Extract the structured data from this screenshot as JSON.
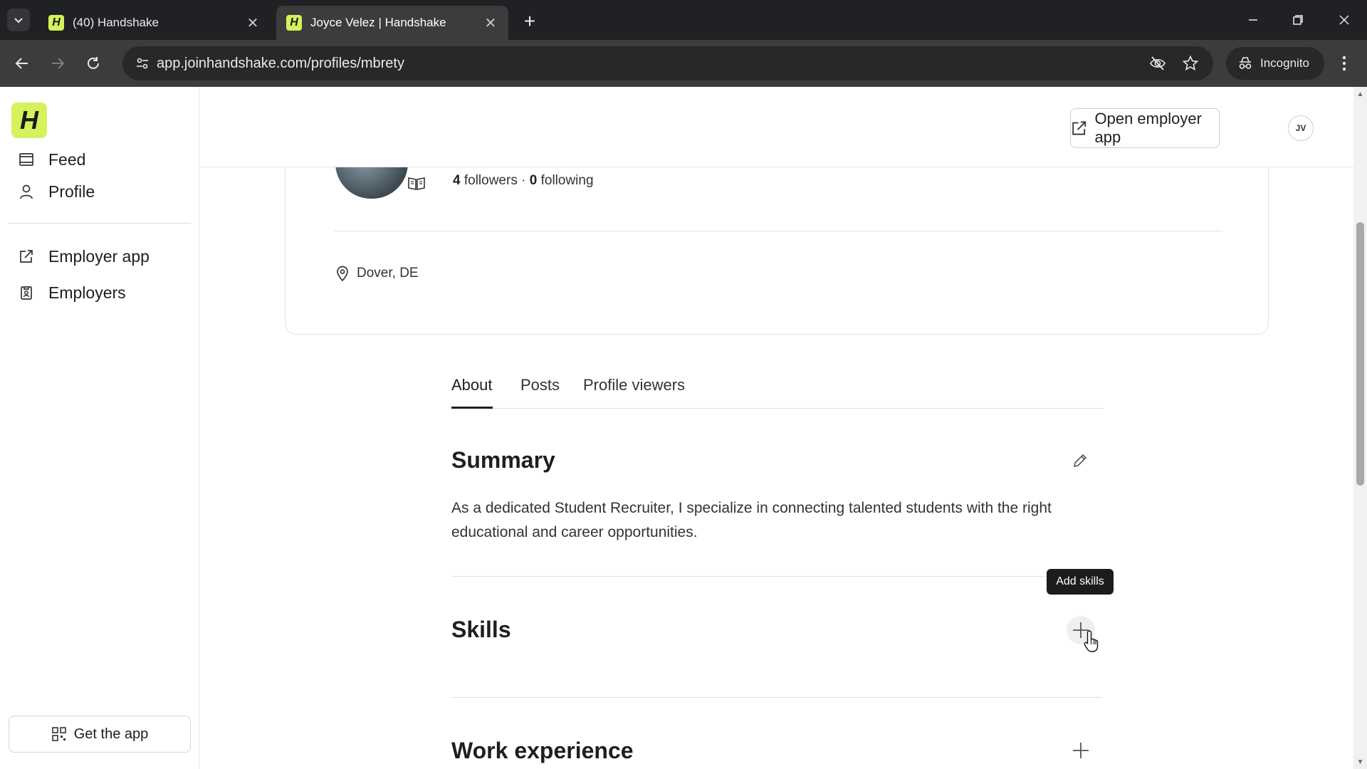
{
  "browser": {
    "tabs": [
      {
        "title": "(40) Handshake",
        "favicon": "H"
      },
      {
        "title": "Joyce Velez | Handshake",
        "favicon": "H"
      }
    ],
    "url": "app.joinhandshake.com/profiles/mbrety",
    "incognito_label": "Incognito"
  },
  "sidebar": {
    "logo": "H",
    "items": [
      {
        "label": "Feed",
        "icon": "feed-icon"
      },
      {
        "label": "Profile",
        "icon": "person-icon"
      },
      {
        "label": "Employer app",
        "icon": "external-link-icon"
      },
      {
        "label": "Employers",
        "icon": "badge-icon"
      }
    ],
    "get_app_label": "Get the app"
  },
  "header": {
    "open_employer_label": "Open employer app",
    "avatar_initials": "JV"
  },
  "profile": {
    "followers_count": "4",
    "followers_label": "followers",
    "separator": "·",
    "following_count": "0",
    "following_label": "following",
    "location": "Dover, DE"
  },
  "tabs": [
    {
      "label": "About",
      "selected": true
    },
    {
      "label": "Posts",
      "selected": false
    },
    {
      "label": "Profile viewers",
      "selected": false
    }
  ],
  "summary": {
    "title": "Summary",
    "text": "As a dedicated Student Recruiter, I specialize in connecting talented students with the right educational and career opportunities."
  },
  "skills": {
    "title": "Skills",
    "tooltip": "Add skills"
  },
  "work_experience": {
    "title": "Work experience"
  },
  "colors": {
    "brand": "#d5f25d",
    "chrome_dark": "#202124",
    "chrome_toolbar": "#3c3c3c"
  }
}
